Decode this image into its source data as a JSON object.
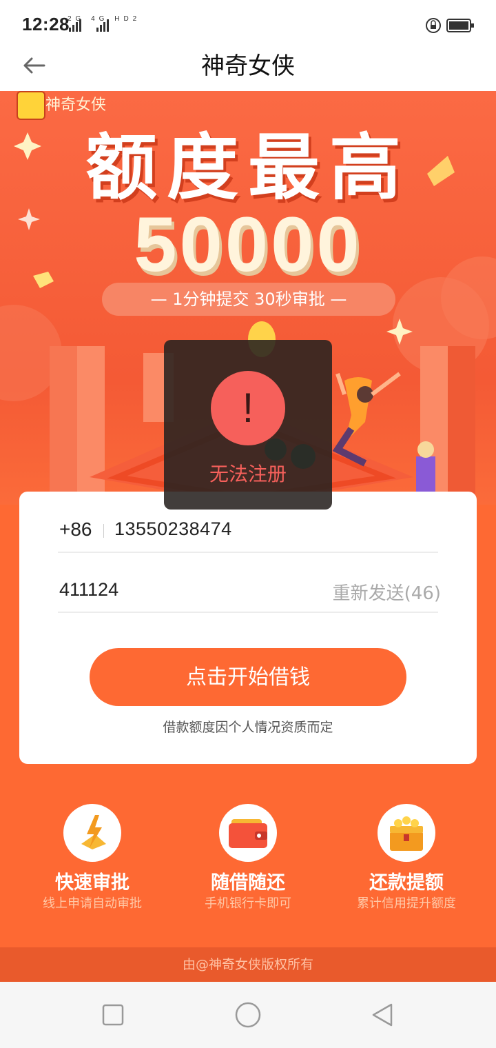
{
  "status_bar": {
    "time": "12:28",
    "signal": "2G 4G HD2"
  },
  "header": {
    "title": "神奇女侠"
  },
  "banner": {
    "brand": "神奇女侠",
    "headline": "额度最高",
    "amount": "50000",
    "tagline": "— 1分钟提交  30秒审批 —"
  },
  "toast": {
    "icon": "!",
    "message": "无法注册"
  },
  "form": {
    "country_code": "+86",
    "phone": "13550238474",
    "code": "411124",
    "resend": "重新发送(46)",
    "cta": "点击开始借钱",
    "note": "借款额度因个人情况资质而定"
  },
  "features": [
    {
      "icon": "lightning-icon",
      "title": "快速审批",
      "subtitle": "线上申请自动审批"
    },
    {
      "icon": "wallet-icon",
      "title": "随借随还",
      "subtitle": "手机银行卡即可"
    },
    {
      "icon": "treasure-chest-icon",
      "title": "还款提额",
      "subtitle": "累计信用提升额度"
    }
  ],
  "footer": {
    "text": "由@神奇女侠版权所有"
  },
  "colors": {
    "accent": "#fe6933",
    "toast_red": "#f6605b"
  }
}
